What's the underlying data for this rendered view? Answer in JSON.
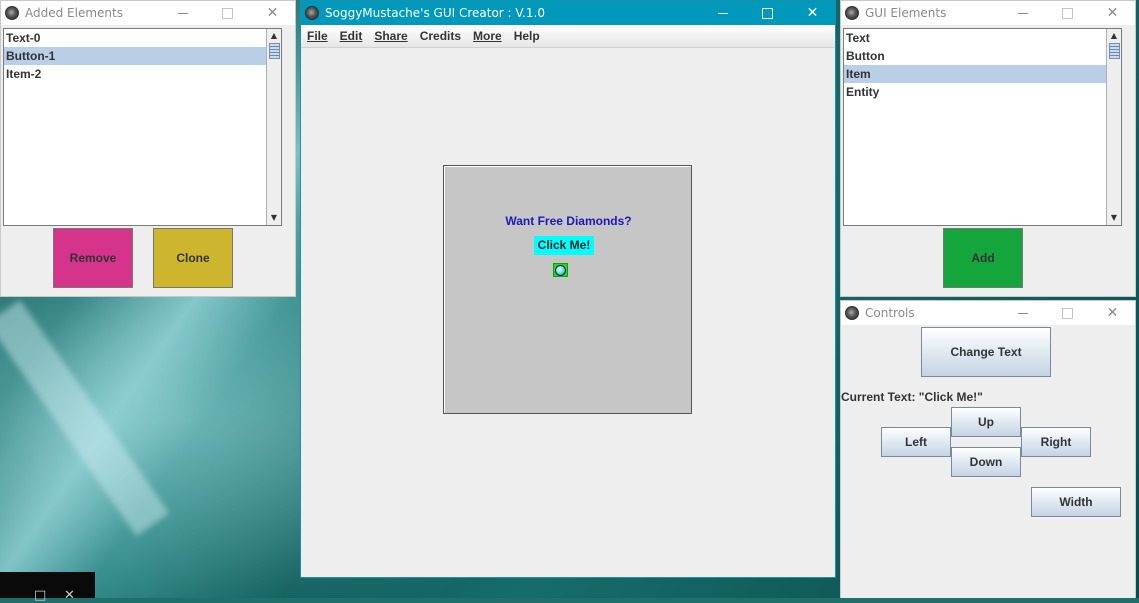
{
  "windows": {
    "added_elements": {
      "title": "Added Elements",
      "items": [
        {
          "label": "Text-0",
          "selected": false
        },
        {
          "label": "Button-1",
          "selected": true
        },
        {
          "label": "Item-2",
          "selected": false
        }
      ],
      "remove_label": "Remove",
      "clone_label": "Clone"
    },
    "main": {
      "title": "SoggyMustache's GUI Creator : V.1.0",
      "menu": [
        "File",
        "Edit",
        "Share",
        "Credits",
        "More",
        "Help"
      ],
      "preview": {
        "heading": "Want Free Diamonds?",
        "button": "Click Me!",
        "item_icon": "diamond-icon"
      }
    },
    "gui_elements": {
      "title": "GUI Elements",
      "items": [
        {
          "label": "Text",
          "selected": false
        },
        {
          "label": "Button",
          "selected": false
        },
        {
          "label": "Item",
          "selected": true
        },
        {
          "label": "Entity",
          "selected": false
        }
      ],
      "add_label": "Add"
    },
    "controls": {
      "title": "Controls",
      "change_text_label": "Change Text",
      "current_text": "Current Text: \"Click Me!\"",
      "up_label": "Up",
      "left_label": "Left",
      "right_label": "Right",
      "down_label": "Down",
      "width_label": "Width"
    }
  },
  "colors": {
    "remove": "#d6338a",
    "clone": "#ceb52e",
    "add": "#14a53c",
    "preview_button": "#00ffff",
    "preview_heading": "#1a1ab8",
    "active_titlebar": "#0099bc",
    "list_selection": "#b8cfe5"
  }
}
